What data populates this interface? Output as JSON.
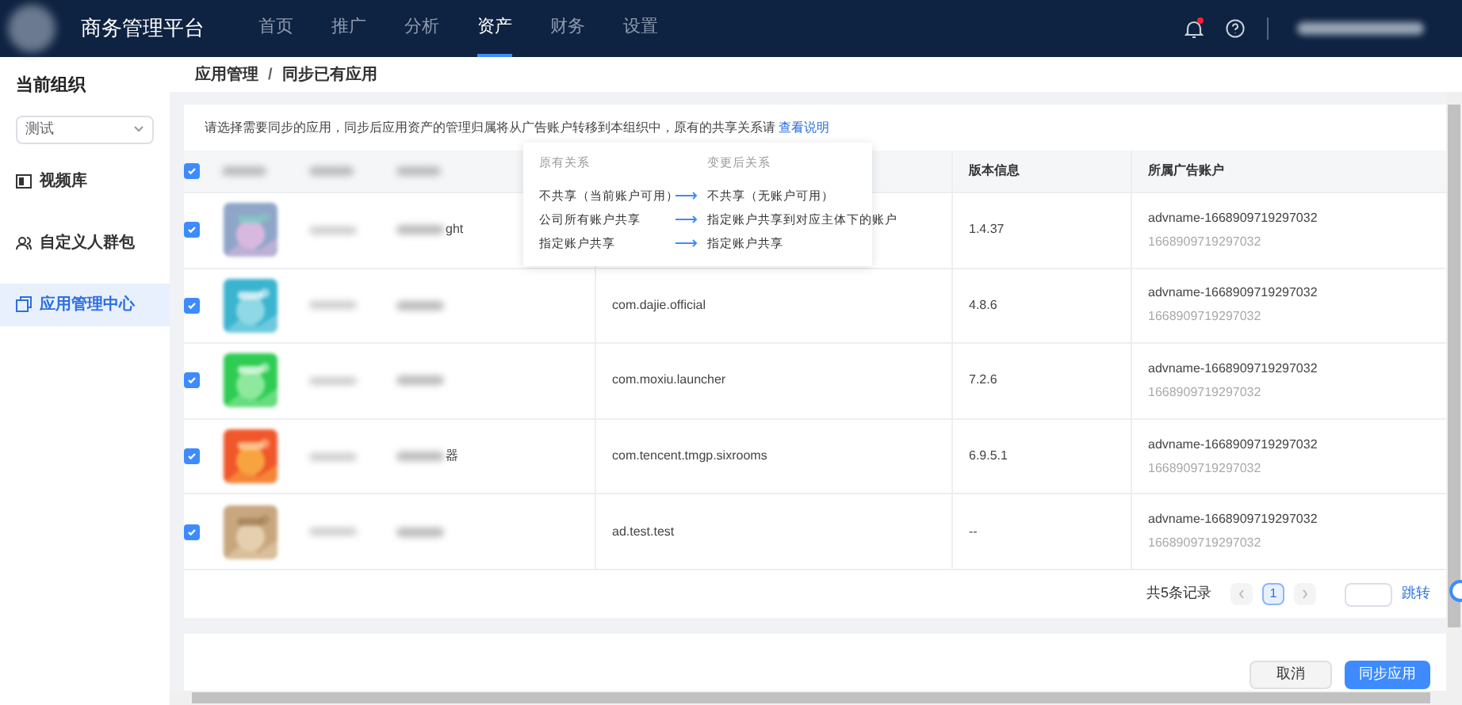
{
  "top_nav": {
    "title": "商务管理平台",
    "items": [
      {
        "label": "首页",
        "selected": false
      },
      {
        "label": "推广",
        "selected": false
      },
      {
        "label": "分析",
        "selected": false
      },
      {
        "label": "资产",
        "selected": true
      },
      {
        "label": "财务",
        "selected": false
      },
      {
        "label": "设置",
        "selected": false
      }
    ],
    "notification_dot": true
  },
  "sidebar": {
    "heading": "当前组织",
    "org_select": "测试",
    "items": [
      {
        "label": "视频库",
        "selected": false
      },
      {
        "label": "自定义人群包",
        "selected": false
      },
      {
        "label": "应用管理中心",
        "selected": true
      }
    ]
  },
  "breadcrumb": [
    "应用管理",
    "同步已有应用"
  ],
  "breadcrumb_separator": "/",
  "intro": {
    "text": "请选择需要同步的应用，同步后应用资产的管理归属将从广告账户转移到本组织中，原有的共享关系请",
    "link": "查看说明"
  },
  "popover": {
    "headers": [
      "原有关系",
      "变更后关系"
    ],
    "rows": [
      {
        "before": "不共享（当前账户可用）",
        "after": "不共享（无账户可用）"
      },
      {
        "before": "公司所有账户共享",
        "after": "指定账户共享到对应主体下的账户"
      },
      {
        "before": "指定账户共享",
        "after": "指定账户共享"
      }
    ]
  },
  "table": {
    "all_checked": true,
    "columns": [
      "版本信息",
      "所属广告账户"
    ],
    "rows": [
      {
        "checked": true,
        "app_name": "ght",
        "version": "1.4.37",
        "account": "advname-1668909719297032",
        "account_id": "1668909719297032"
      },
      {
        "checked": true,
        "package": "com.dajie.official",
        "version": "4.8.6",
        "account": "advname-1668909719297032",
        "account_id": "1668909719297032"
      },
      {
        "checked": true,
        "package": "com.moxiu.launcher",
        "version": "7.2.6",
        "account": "advname-1668909719297032",
        "account_id": "1668909719297032"
      },
      {
        "checked": true,
        "app_name": "器",
        "package": "com.tencent.tmgp.sixrooms",
        "version": "6.9.5.1",
        "account": "advname-1668909719297032",
        "account_id": "1668909719297032"
      },
      {
        "checked": true,
        "package": "ad.test.test",
        "version": "--",
        "account": "advname-1668909719297032",
        "account_id": "1668909719297032"
      }
    ]
  },
  "pagination": {
    "total": "共5条记录",
    "pages": [
      {
        "label": "1",
        "selected": true
      }
    ],
    "jump": "跳转"
  },
  "footer": {
    "cancel": "取消",
    "confirm": "同步应用"
  }
}
